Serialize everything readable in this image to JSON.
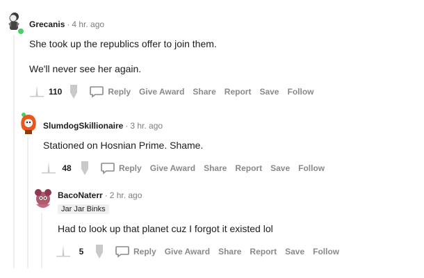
{
  "comments": [
    {
      "author": "Grecanis",
      "time": "4 hr. ago",
      "lines": [
        "She took up the republics offer to join them.",
        "We'll never see her again."
      ],
      "votes": "110",
      "actions": {
        "reply": "Reply",
        "give_award": "Give Award",
        "share": "Share",
        "report": "Report",
        "save": "Save",
        "follow": "Follow"
      }
    },
    {
      "author": "SlumdogSkillionaire",
      "time": "3 hr. ago",
      "lines": [
        "Stationed on Hosnian Prime. Shame."
      ],
      "votes": "48",
      "actions": {
        "reply": "Reply",
        "give_award": "Give Award",
        "share": "Share",
        "report": "Report",
        "save": "Save",
        "follow": "Follow"
      }
    },
    {
      "author": "BacoNaterr",
      "time": "2 hr. ago",
      "flair": "Jar Jar Binks",
      "lines": [
        "Had to look up that planet cuz I forgot it existed lol"
      ],
      "votes": "5",
      "actions": {
        "reply": "Reply",
        "give_award": "Give Award",
        "share": "Share",
        "report": "Report",
        "save": "Save",
        "follow": "Follow"
      }
    }
  ],
  "separator": "·"
}
